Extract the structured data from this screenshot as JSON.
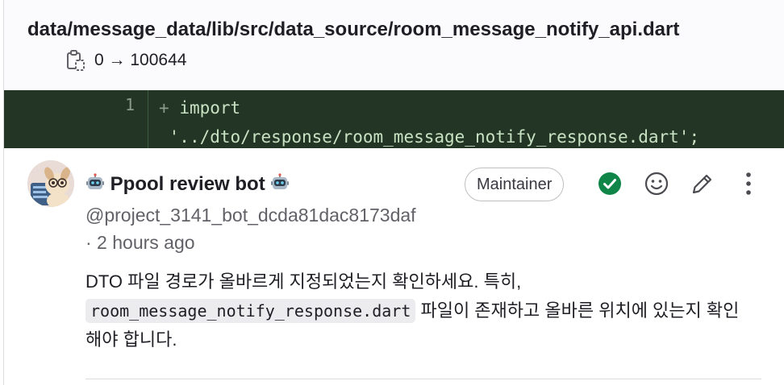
{
  "file": {
    "path": "data/message_data/lib/src/data_source/room_message_notify_api.dart",
    "mode_change": "0 → 100644"
  },
  "diff": {
    "line_number": "1",
    "marker": "+",
    "code_line1": "import",
    "code_line2": "'../dto/response/room_message_notify_response.dart';",
    "colors": {
      "background": "#233625",
      "text": "#c8e1c3"
    }
  },
  "comment": {
    "author_name": "Ppool review bot",
    "author_emoji": "🤖",
    "handle": "@project_3141_bot_dcda81dac8173daf",
    "time": "· 2 hours ago",
    "role_badge": "Maintainer",
    "body_part1": "DTO 파일 경로가 올바르게 지정되었는지 확인하세요. 특히, ",
    "body_code": "room_message_notify_response.dart",
    "body_part2": " 파일이 존재하고 올바른 위치에 있는지 확인해야 합니다.",
    "actions": [
      "resolve-thread-icon",
      "add-reaction-icon",
      "edit-icon",
      "more-actions-icon"
    ],
    "colors": {
      "resolved": "#108548"
    }
  }
}
